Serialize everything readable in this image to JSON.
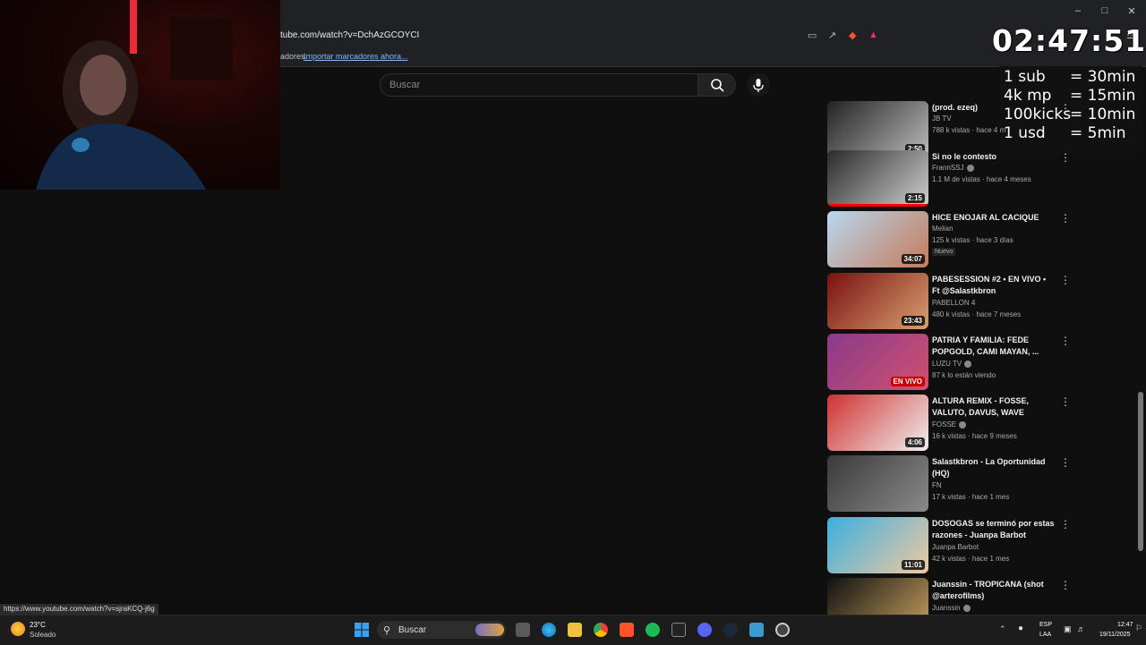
{
  "browser": {
    "url": "tube.com/watch?v=DchAzGCOYCI",
    "bookmarks_prefix": "adores.",
    "bookmarks_link": "Importar marcadores ahora..."
  },
  "search": {
    "placeholder": "Buscar"
  },
  "overlay": {
    "timer": "02:47:51",
    "rates": [
      {
        "label": "1 sub",
        "value": "= 30min"
      },
      {
        "label": "4k mp",
        "value": "= 15min"
      },
      {
        "label": "100kicks",
        "value": "= 10min"
      },
      {
        "label": "1 usd",
        "value": "=  5min"
      }
    ]
  },
  "videos": [
    {
      "title": "(prod. ezeq)",
      "channel": "JB TV",
      "meta": "788 k vistas · hace 4 m",
      "duration": "2:50",
      "colors": [
        "#222",
        "#bbb"
      ],
      "watched": 0.55
    },
    {
      "title": "Si no le contesto",
      "channel": "FrannSSJ",
      "verified": true,
      "meta": "1.1 M de vistas · hace 4 meses",
      "duration": "2:15",
      "colors": [
        "#2a2a2a",
        "#cfcfcf"
      ],
      "watched": 1.0
    },
    {
      "title": "HICE ENOJAR AL CACIQUE",
      "channel": "Melian",
      "meta": "125 k vistas · hace 3 días",
      "badge": "Nuevo",
      "duration": "34:07",
      "colors": [
        "#b8d8f0",
        "#c67a5a"
      ]
    },
    {
      "title": "PABESESSION #2 • EN VIVO • Ft @Salastkbron",
      "channel": "PABELLON 4",
      "meta": "480 k vistas · hace 7 meses",
      "duration": "23:43",
      "colors": [
        "#7a1010",
        "#d8a070"
      ]
    },
    {
      "title": "PATRIA Y FAMILIA: FEDE POPGOLD, CAMI MAYAN, ...",
      "channel": "LUZU TV",
      "verified": true,
      "meta": "87 k lo están viendo",
      "live": "EN VIVO",
      "colors": [
        "#8a3a8a",
        "#d05070"
      ]
    },
    {
      "title": "ALTURA REMIX - FOSSE, VALUTO, DAVUS, WAVE",
      "channel": "FOSSE",
      "verified": true,
      "meta": "16 k vistas · hace 9 meses",
      "duration": "4:06",
      "colors": [
        "#d03030",
        "#f0f0f0"
      ]
    },
    {
      "title": "Salastkbron - La Oportunidad (HQ)",
      "channel": "FN",
      "meta": "17 k vistas · hace 1 mes",
      "colors": [
        "#3a3a3a",
        "#8a8a8a"
      ]
    },
    {
      "title": "DOSOGAS se terminó por estas razones - Juanpa Barbot",
      "channel": "Juanpa Barbot",
      "meta": "42 k vistas · hace 1 mes",
      "duration": "11:01",
      "colors": [
        "#3ab0e0",
        "#f0c8a0"
      ]
    },
    {
      "title": "Juanssin - TROPICANA (shot @arterofilms)",
      "channel": "Juanssin",
      "verified": true,
      "meta": "",
      "colors": [
        "#111",
        "#c8a060"
      ]
    }
  ],
  "status_url": "https://www.youtube.com/watch?v=sjraKCQ-j6g",
  "taskbar": {
    "weather_temp": "23°C",
    "weather_desc": "Soleado",
    "search_label": "Buscar",
    "lang_line1": "ESP",
    "lang_line2": "LAA",
    "time": "12:47",
    "date": "19/11/2025"
  }
}
